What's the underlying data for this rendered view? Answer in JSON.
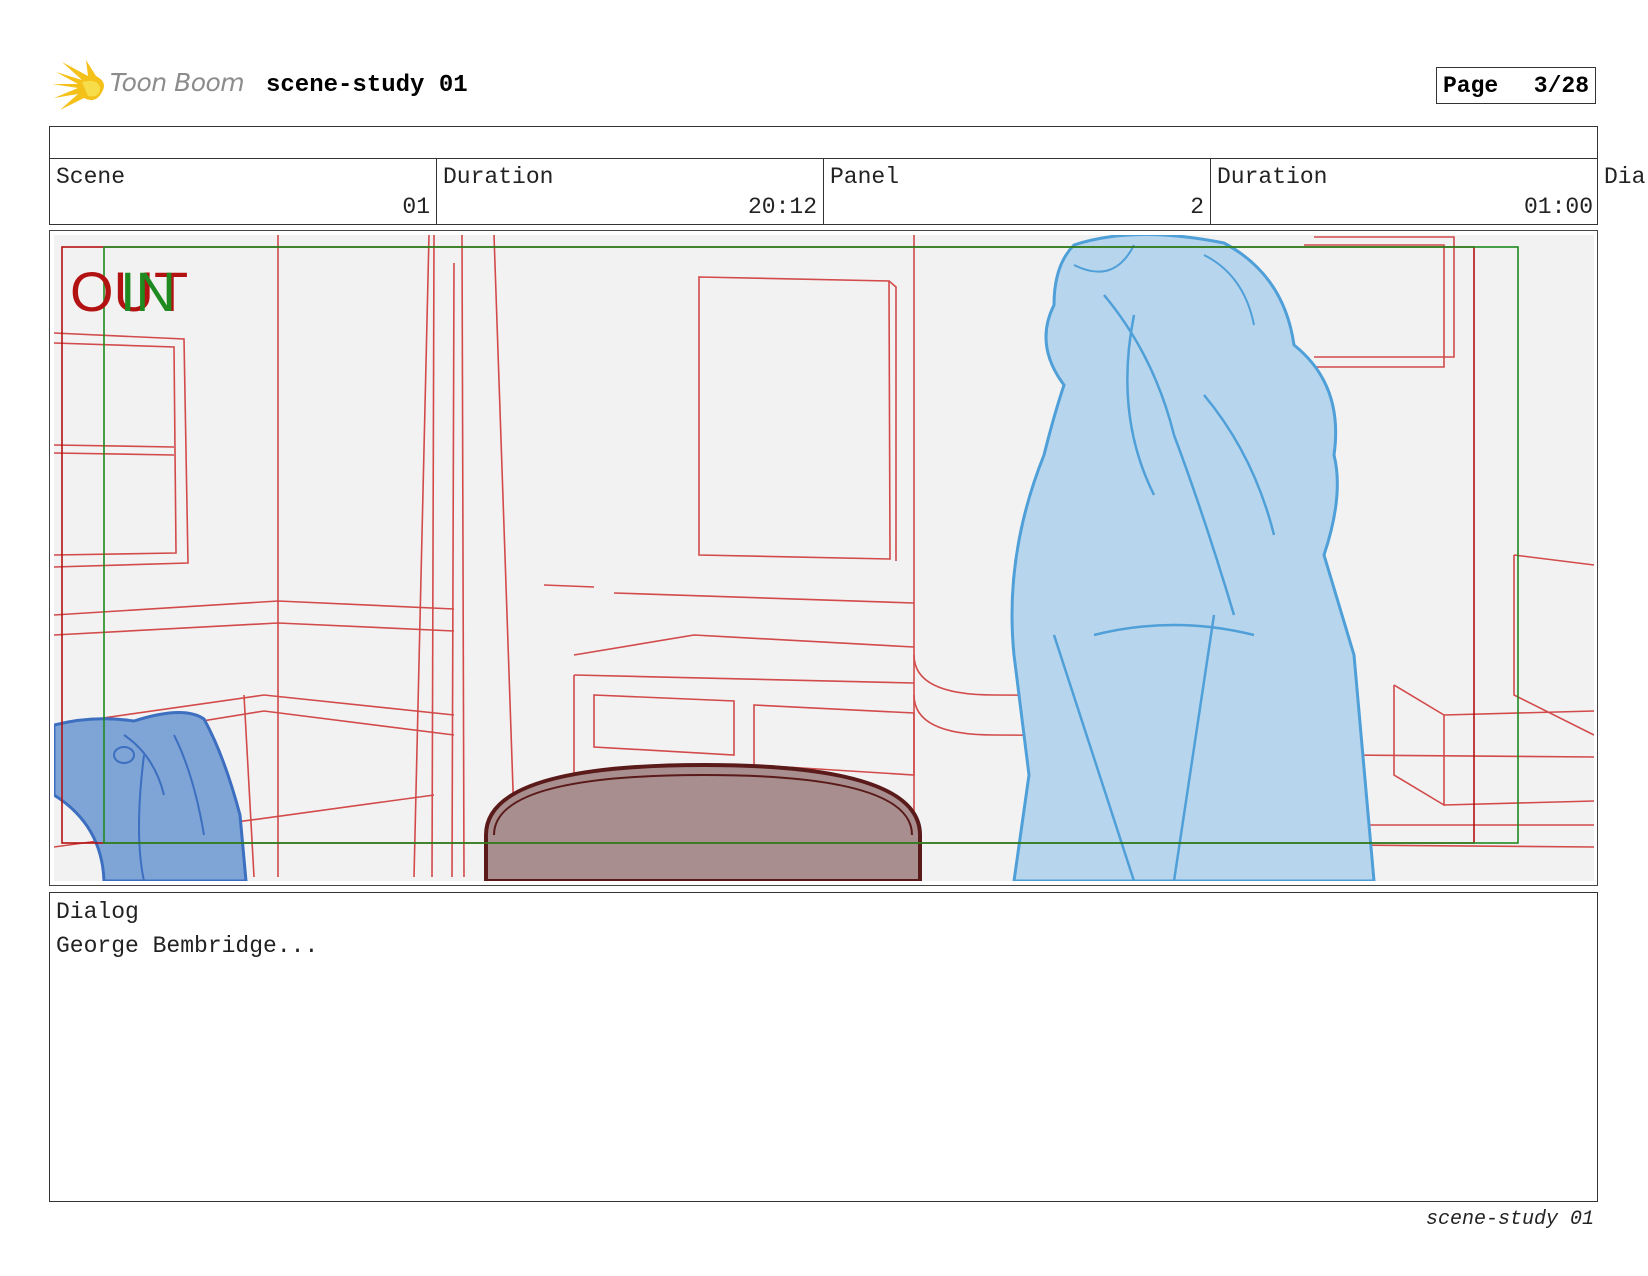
{
  "header": {
    "logo_text": "Toon Boom",
    "title": "scene-study 01",
    "page_label": "Page",
    "page_value": "3/28"
  },
  "info": {
    "scene_label": "Scene",
    "scene_value": "01",
    "scene_duration_label": "Duration",
    "scene_duration_value": "20:12",
    "panel_label": "Panel",
    "panel_value": "2",
    "panel_duration_label": "Duration",
    "panel_duration_value": "01:00",
    "overflow_label": "Dia"
  },
  "panel": {
    "out_label": "OUT",
    "in_label": "IN",
    "out_color": "#b31212",
    "in_color": "#1f8a1f",
    "layout_color": "#d24a4a",
    "character_color": "#4f9fd8",
    "prop_color": "#3d6fc0",
    "table_color": "#a88e8e"
  },
  "dialog": {
    "label": "Dialog",
    "text": "George Bembridge..."
  },
  "footer": {
    "text": "scene-study 01"
  }
}
